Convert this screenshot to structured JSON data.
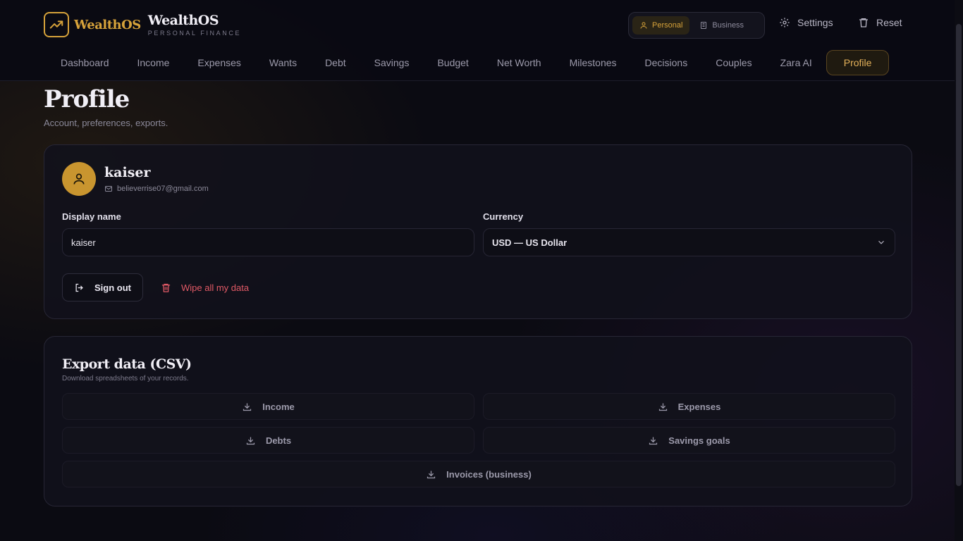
{
  "brand": {
    "logo_word": "WealthOS",
    "title": "WealthOS",
    "subtitle": "PERSONAL FINANCE"
  },
  "mode": {
    "personal": "Personal",
    "business": "Business"
  },
  "top_actions": {
    "settings": "Settings",
    "reset": "Reset"
  },
  "nav": [
    {
      "label": "Dashboard"
    },
    {
      "label": "Income"
    },
    {
      "label": "Expenses"
    },
    {
      "label": "Wants"
    },
    {
      "label": "Debt"
    },
    {
      "label": "Savings"
    },
    {
      "label": "Budget"
    },
    {
      "label": "Net Worth"
    },
    {
      "label": "Milestones"
    },
    {
      "label": "Decisions"
    },
    {
      "label": "Couples"
    },
    {
      "label": "Zara AI"
    },
    {
      "label": "Profile"
    }
  ],
  "page": {
    "title": "Profile",
    "subtitle": "Account, preferences, exports."
  },
  "profile": {
    "name": "kaiser",
    "email": "believerrise07@gmail.com",
    "display_name_label": "Display name",
    "display_name_value": "kaiser",
    "currency_label": "Currency",
    "currency_value": "USD — US Dollar",
    "sign_out": "Sign out",
    "wipe": "Wipe all my data"
  },
  "export": {
    "title": "Export data (CSV)",
    "subtitle": "Download spreadsheets of your records.",
    "buttons": [
      {
        "label": "Income"
      },
      {
        "label": "Expenses"
      },
      {
        "label": "Debts"
      },
      {
        "label": "Savings goals"
      },
      {
        "label": "Invoices (business)"
      }
    ]
  },
  "colors": {
    "accent": "#d6a23a",
    "danger": "#e25a66",
    "background": "#0b0b12"
  }
}
